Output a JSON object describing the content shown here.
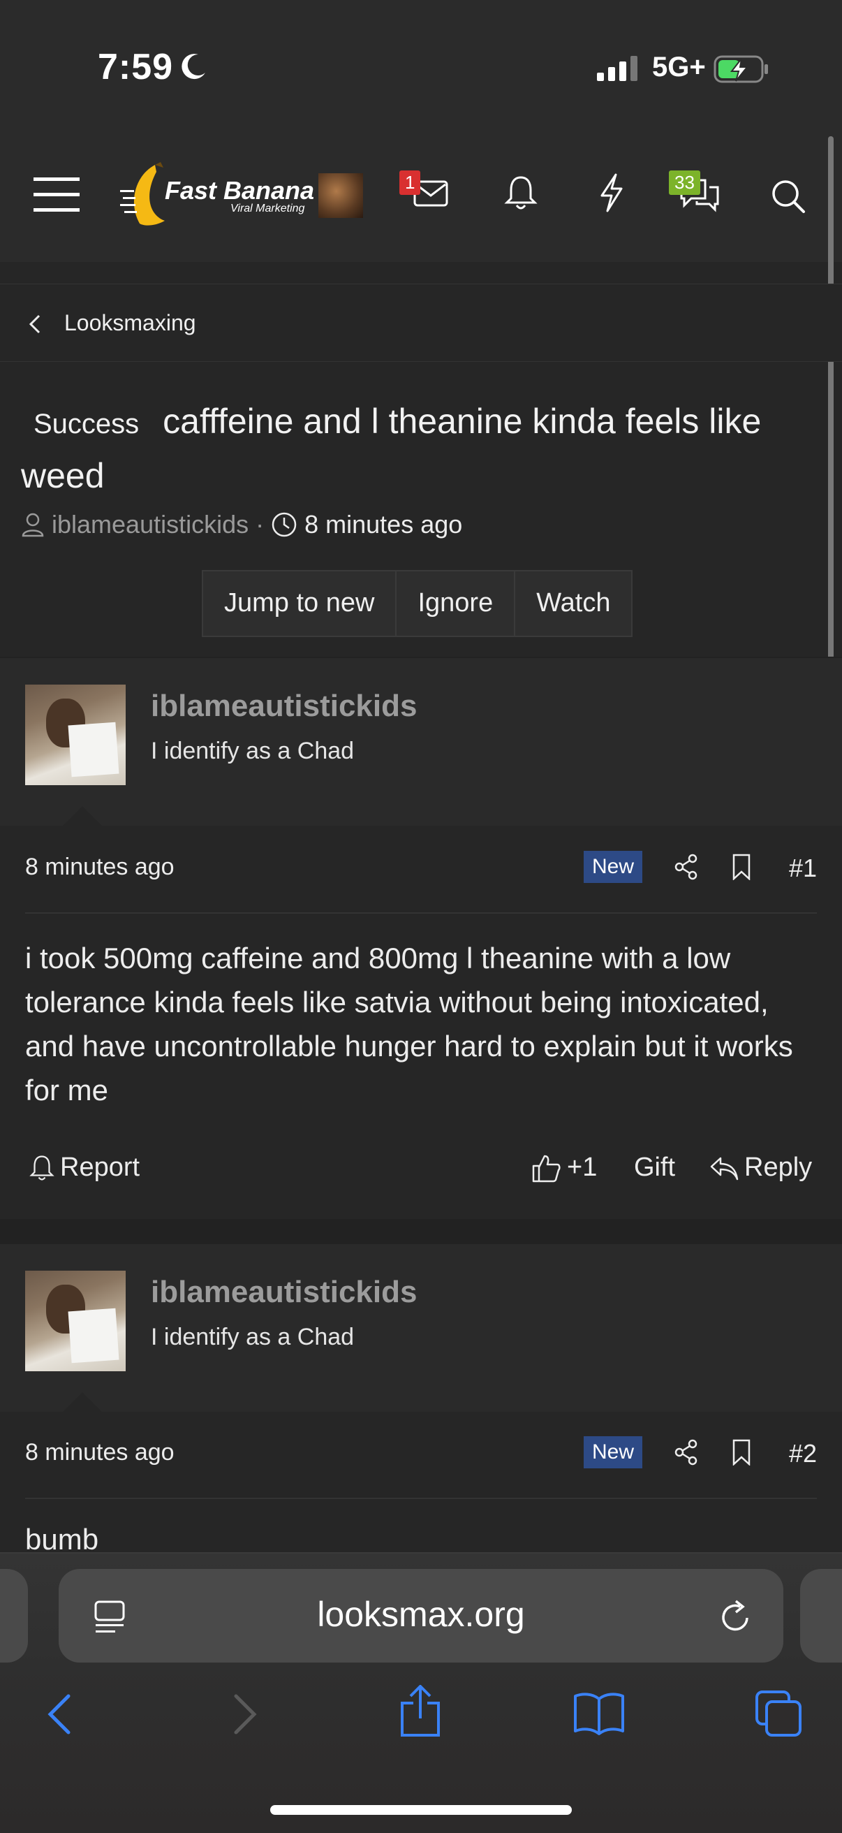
{
  "status_bar": {
    "time": "7:59",
    "network": "5G+",
    "icons": [
      "moon-icon",
      "signal-icon",
      "battery-charging-icon"
    ]
  },
  "nav": {
    "logo_title": "Fast Banana",
    "logo_subtitle": "Viral Marketing",
    "messages_badge": "1",
    "conversations_badge": "33",
    "icons": [
      "menu-icon",
      "user-avatar",
      "envelope-icon",
      "bell-icon",
      "lightning-icon",
      "chat-icon",
      "search-icon"
    ]
  },
  "breadcrumb": {
    "label": "Looksmaxing"
  },
  "thread": {
    "prefix": "Success",
    "title": "cafffeine and l theanine kinda feels like weed",
    "author": "iblameautistickids",
    "separator": "·",
    "time_ago": "8 minutes ago",
    "buttons": [
      "Jump to new",
      "Ignore",
      "Watch"
    ]
  },
  "posts": [
    {
      "username": "iblameautistickids",
      "user_title": "I identify as a Chad",
      "time": "8 minutes ago",
      "new_label": "New",
      "number": "#1",
      "body": "i took 500mg caffeine and 800mg l theanine with a low tolerance kinda feels like satvia without being intoxicated, and have uncontrollable hunger hard to explain but it works for me",
      "actions": {
        "report": "Report",
        "like": "+1",
        "gift": "Gift",
        "reply": "Reply"
      }
    },
    {
      "username": "iblameautistickids",
      "user_title": "I identify as a Chad",
      "time": "8 minutes ago",
      "new_label": "New",
      "number": "#2",
      "body": "bumb"
    }
  ],
  "browser": {
    "url": "looksmax.org",
    "toolbar_icons": [
      "back-icon",
      "forward-icon",
      "share-icon",
      "bookmarks-icon",
      "tabs-icon"
    ],
    "accent_color": "#3a82f7"
  }
}
